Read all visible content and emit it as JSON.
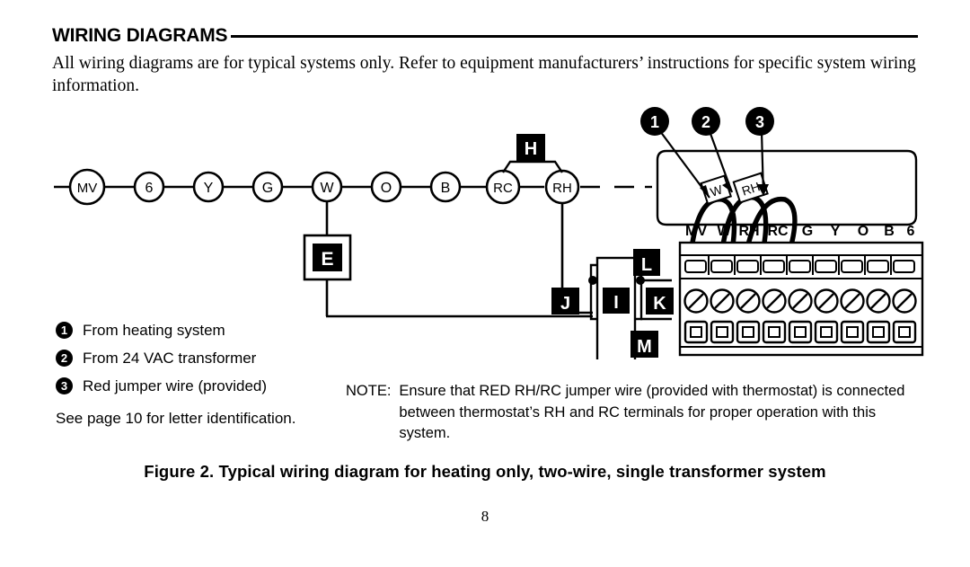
{
  "header": {
    "title": "WIRING DIAGRAMS",
    "intro": "All wiring diagrams are for typical systems only. Refer to equipment manufacturers’ instructions for specific system wiring information."
  },
  "diagram": {
    "terminal_circles": [
      {
        "id": "MV",
        "label": "MV"
      },
      {
        "id": "6",
        "label": "6"
      },
      {
        "id": "Y",
        "label": "Y"
      },
      {
        "id": "G",
        "label": "G"
      },
      {
        "id": "W",
        "label": "W"
      },
      {
        "id": "O",
        "label": "O"
      },
      {
        "id": "B",
        "label": "B"
      },
      {
        "id": "RC",
        "label": "RC"
      },
      {
        "id": "RH",
        "label": "RH"
      }
    ],
    "letter_callouts": [
      {
        "id": "H",
        "label": "H"
      },
      {
        "id": "E",
        "label": "E"
      },
      {
        "id": "J",
        "label": "J"
      },
      {
        "id": "I",
        "label": "I"
      },
      {
        "id": "K",
        "label": "K"
      },
      {
        "id": "L",
        "label": "L"
      },
      {
        "id": "M",
        "label": "M"
      }
    ],
    "number_callouts": [
      "1",
      "2",
      "3"
    ],
    "wire_tags": [
      "W",
      "RH"
    ],
    "thermostat_terminals": [
      "MV",
      "W",
      "RH",
      "RC",
      "G",
      "Y",
      "O",
      "B",
      "6"
    ]
  },
  "legend": {
    "items": [
      {
        "number": "1",
        "text": "From heating system"
      },
      {
        "number": "2",
        "text": "From 24 VAC transformer"
      },
      {
        "number": "3",
        "text": "Red jumper wire (provided)"
      }
    ],
    "footnote": "See page 10 for letter identification."
  },
  "note": {
    "label": "NOTE:",
    "text": "Ensure that RED RH/RC jumper wire (provided with thermostat) is connected between thermostat’s RH and RC terminals for proper operation with this system."
  },
  "footer": {
    "caption": "Figure 2. Typical wiring diagram for heating only, two-wire, single transformer system",
    "page_number": "8"
  },
  "colors": {
    "ink": "#000000",
    "paper": "#ffffff"
  }
}
